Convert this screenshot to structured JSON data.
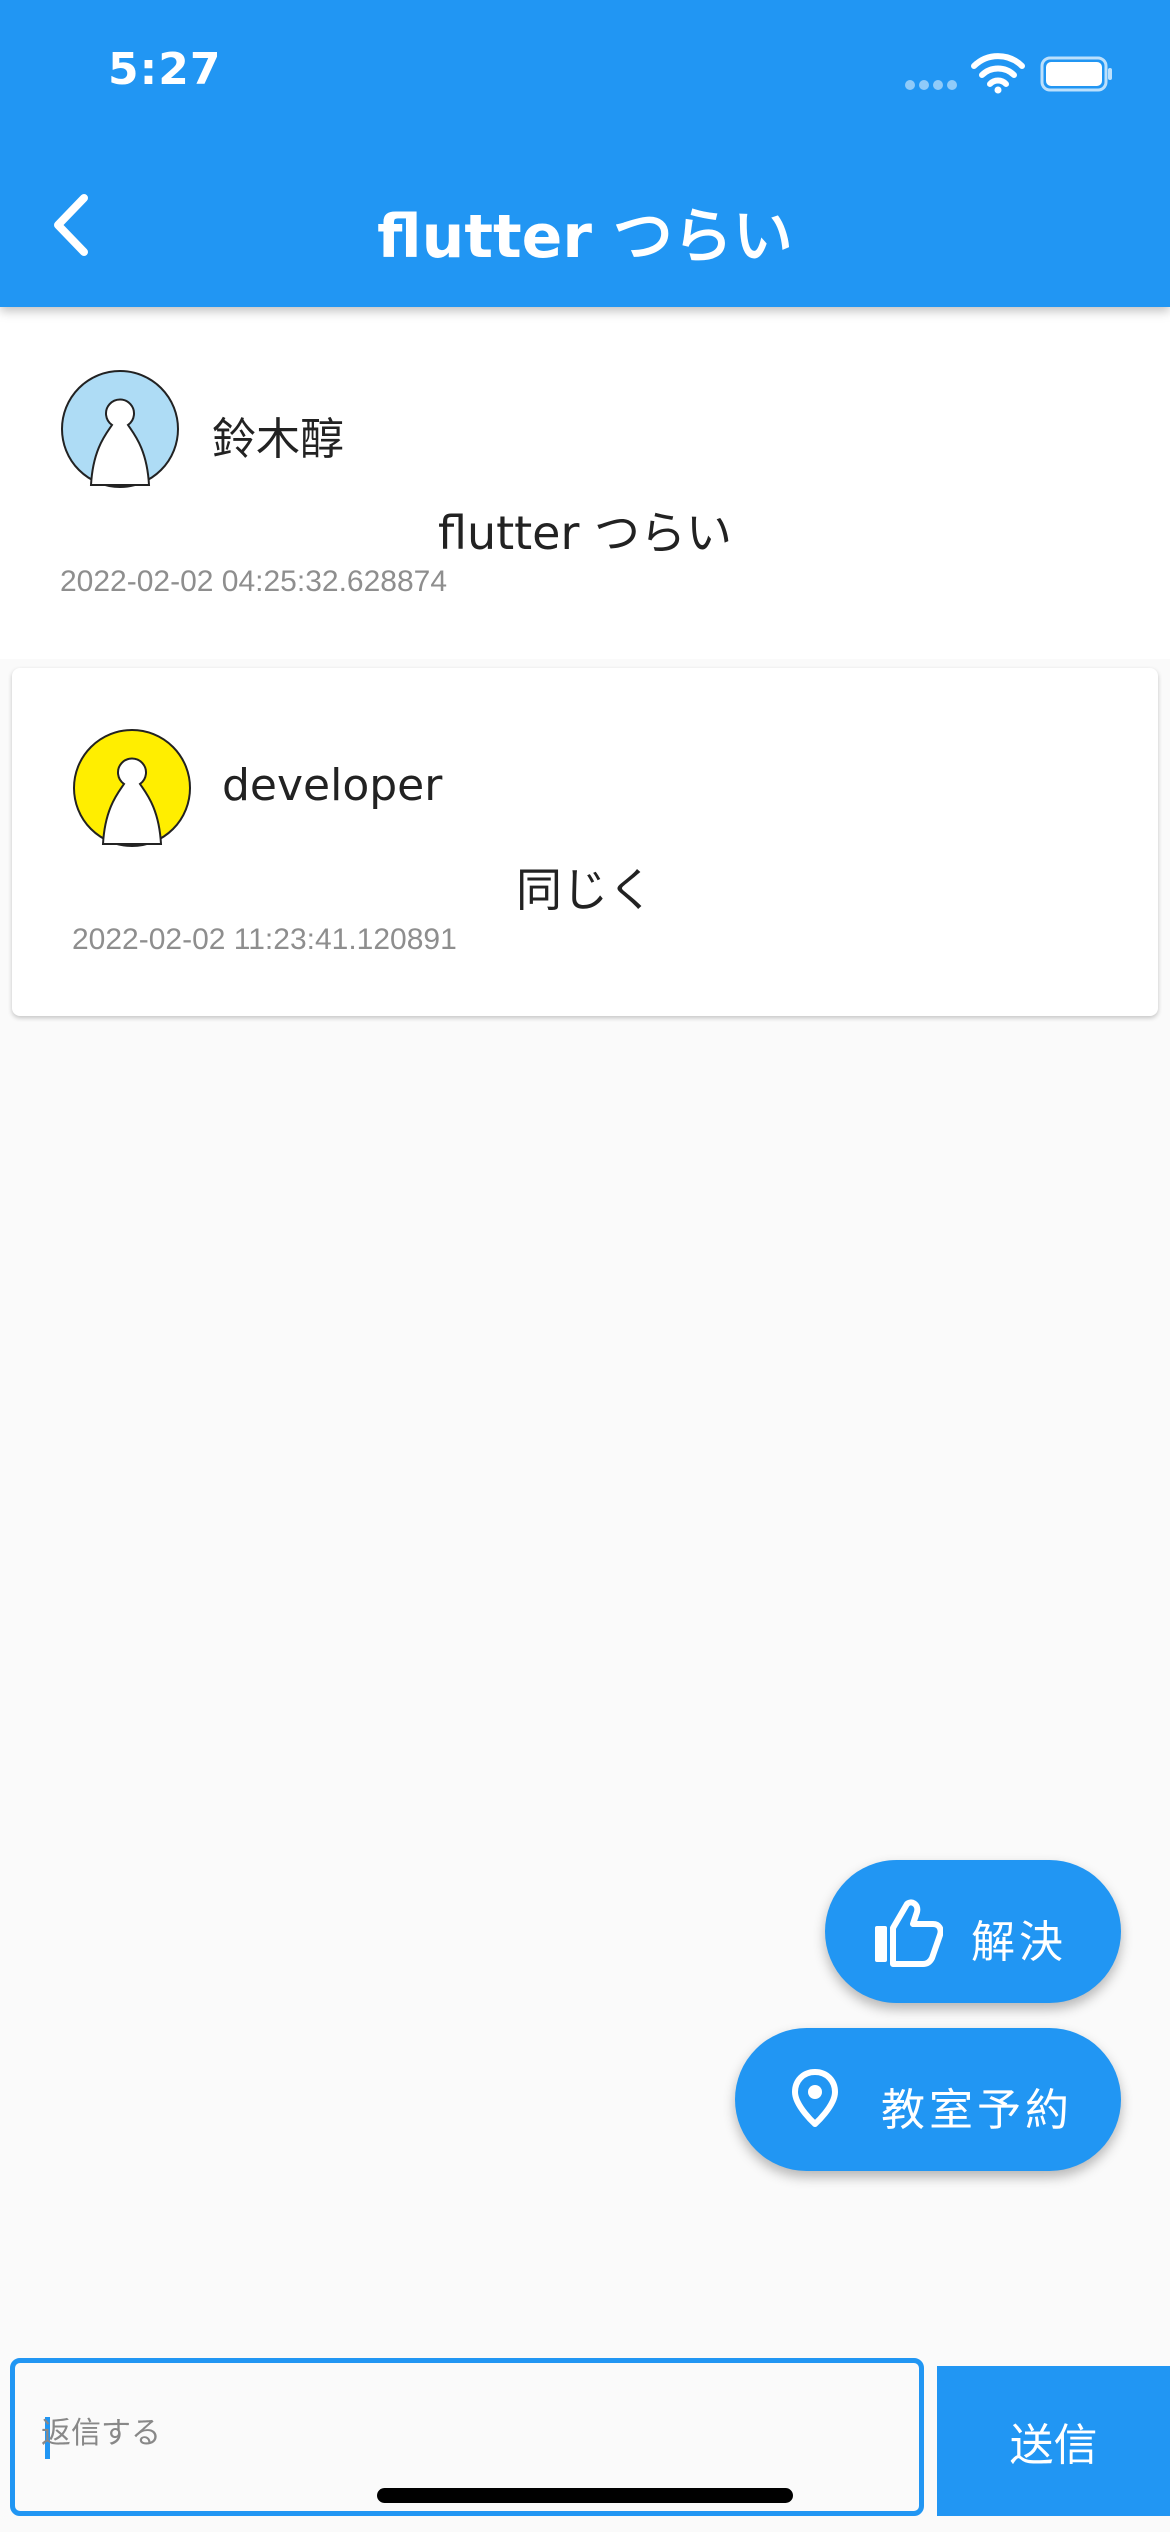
{
  "status_bar": {
    "time": "5:27"
  },
  "app_bar": {
    "title": "flutter つらい",
    "back_icon": "chevron-left-icon",
    "color": "#2196f3"
  },
  "posts": [
    {
      "author": "鈴木醇",
      "message": "flutter つらい",
      "timestamp": "2022-02-02 04:25:32.628874",
      "avatar_icon": "person-icon",
      "avatar_color": "#aedcf5"
    },
    {
      "author": "developer",
      "message": "同じく",
      "timestamp": "2022-02-02 11:23:41.120891",
      "avatar_icon": "person-icon",
      "avatar_color": "#ffee00"
    }
  ],
  "actions": {
    "resolve": {
      "label": "解決",
      "icon": "thumbs-up-icon"
    },
    "reserve": {
      "label": "教室予約",
      "icon": "location-pin-icon"
    }
  },
  "reply": {
    "placeholder": "返信する",
    "value": "",
    "send_label": "送信"
  }
}
